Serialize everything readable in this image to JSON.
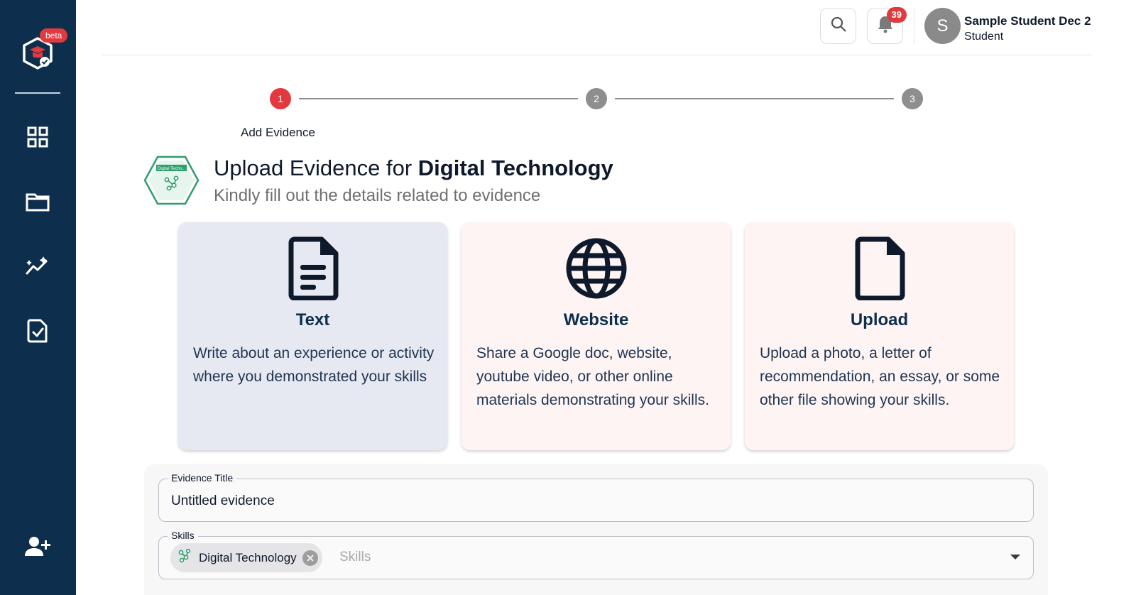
{
  "sidebar": {
    "beta_badge": "beta",
    "items": [
      {
        "name": "dashboard",
        "icon": "grid-icon"
      },
      {
        "name": "portfolio",
        "icon": "folder-icon"
      },
      {
        "name": "insights",
        "icon": "chart-sparkle-icon"
      },
      {
        "name": "verification",
        "icon": "badge-check-icon"
      },
      {
        "name": "invite",
        "icon": "add-user-icon"
      }
    ]
  },
  "header": {
    "notification_count": "39",
    "user": {
      "initial": "S",
      "name": "Sample Student Dec 2",
      "role": "Student"
    }
  },
  "stepper": {
    "steps": [
      "1",
      "2",
      "3"
    ],
    "active_step": 1,
    "active_label": "Add Evidence",
    "colors": {
      "active": "#e03a3e",
      "inactive": "#8e8e8e"
    }
  },
  "page": {
    "heading_prefix": "Upload Evidence for",
    "heading_skill": "Digital Technology",
    "subtitle": "Kindly fill out the details related to evidence",
    "badge_text": "Digital Techn..."
  },
  "evidence_types": [
    {
      "title": "Text",
      "description": "Write about an experience or activity where you demonstrated your skills",
      "icon": "document-icon",
      "selected": true
    },
    {
      "title": "Website",
      "description": "Share a Google doc, website, youtube video, or other online materials demonstrating your skills.",
      "icon": "globe-icon",
      "selected": false
    },
    {
      "title": "Upload",
      "description": "Upload a photo, a letter of recommendation, an essay, or some other file showing your skills.",
      "icon": "file-icon",
      "selected": false
    }
  ],
  "form": {
    "title_label": "Evidence Title",
    "title_value": "Untitled evidence",
    "skills_label": "Skills",
    "skills_placeholder": "Skills",
    "skill_chip": "Digital Technology"
  },
  "colors": {
    "sidebar": "#0d2f4d",
    "accent": "#e03a3e",
    "skill_green": "#2e9e6a"
  }
}
